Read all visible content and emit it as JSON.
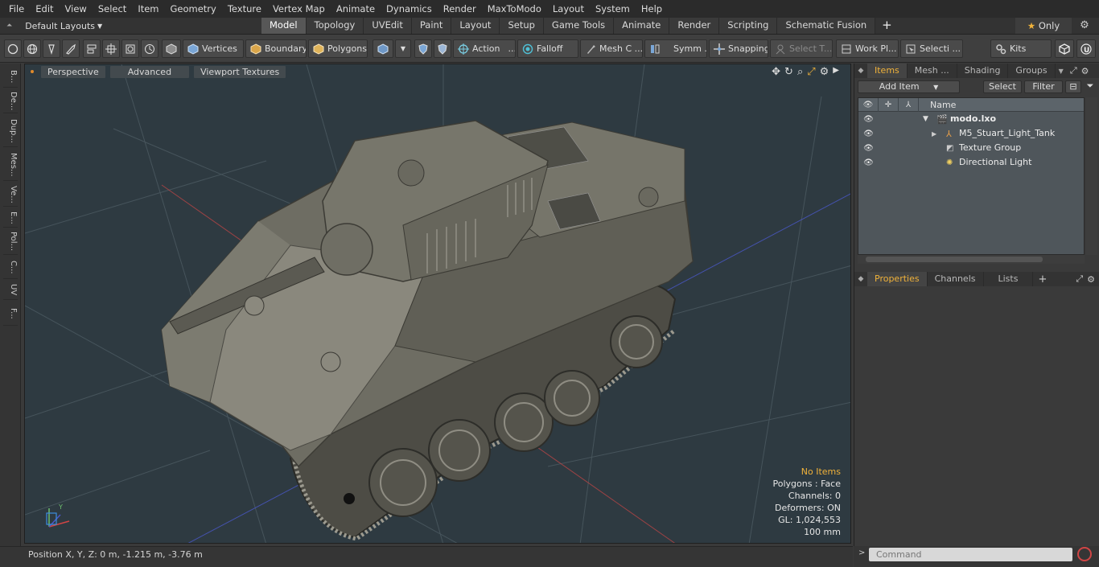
{
  "menubar": [
    "File",
    "Edit",
    "View",
    "Select",
    "Item",
    "Geometry",
    "Texture",
    "Vertex Map",
    "Animate",
    "Dynamics",
    "Render",
    "MaxToModo",
    "Layout",
    "System",
    "Help"
  ],
  "modebar": {
    "layout_label": "Default Layouts",
    "tabs": [
      "Model",
      "Topology",
      "UVEdit",
      "Paint",
      "Layout",
      "Setup",
      "Game Tools",
      "Animate",
      "Render",
      "Scripting",
      "Schematic Fusion"
    ],
    "active_tab": "Model",
    "only_label": "Only"
  },
  "toolbar": {
    "vertices": "Vertices",
    "boundary": "Boundary",
    "polygons": "Polygons",
    "action": "Action",
    "falloff": "Falloff",
    "meshc": "Mesh C ...",
    "symm": "Symm ...",
    "snapping": "Snapping",
    "select_t": "Select T...",
    "workpl": "Work Pl...",
    "selecti": "Selecti ...",
    "kits": "Kits"
  },
  "leftstrip": [
    "B...",
    "De...",
    "Dup...",
    "Mes...",
    "Ve...",
    "E...",
    "Pol...",
    "C...",
    "UV",
    "F..."
  ],
  "viewport": {
    "buttons": [
      "Perspective",
      "Advanced",
      "Viewport Textures"
    ],
    "stats": {
      "no_items": "No Items",
      "polygons": "Polygons : Face",
      "channels": "Channels: 0",
      "deformers": "Deformers: ON",
      "gl": "GL: 1,024,553",
      "size": "100 mm"
    }
  },
  "statusbar": {
    "position": "Position X, Y, Z:   0 m, -1.215 m, -3.76 m"
  },
  "items_panel": {
    "tabs": [
      "Items",
      "Mesh ...",
      "Shading",
      "Groups"
    ],
    "add_item": "Add Item",
    "select": "Select",
    "filter": "Filter",
    "column_name": "Name",
    "tree": [
      {
        "label": "modo.lxo",
        "bold": true
      },
      {
        "label": "M5_Stuart_Light_Tank"
      },
      {
        "label": "Texture Group"
      },
      {
        "label": "Directional Light"
      }
    ]
  },
  "properties_panel": {
    "tabs": [
      "Properties",
      "Channels",
      "Lists"
    ]
  },
  "command": {
    "placeholder": "Command"
  },
  "colors": {
    "accent": "#f0b23a",
    "viewport_bg": "#2e3a41",
    "tank": "#6b6a60"
  }
}
